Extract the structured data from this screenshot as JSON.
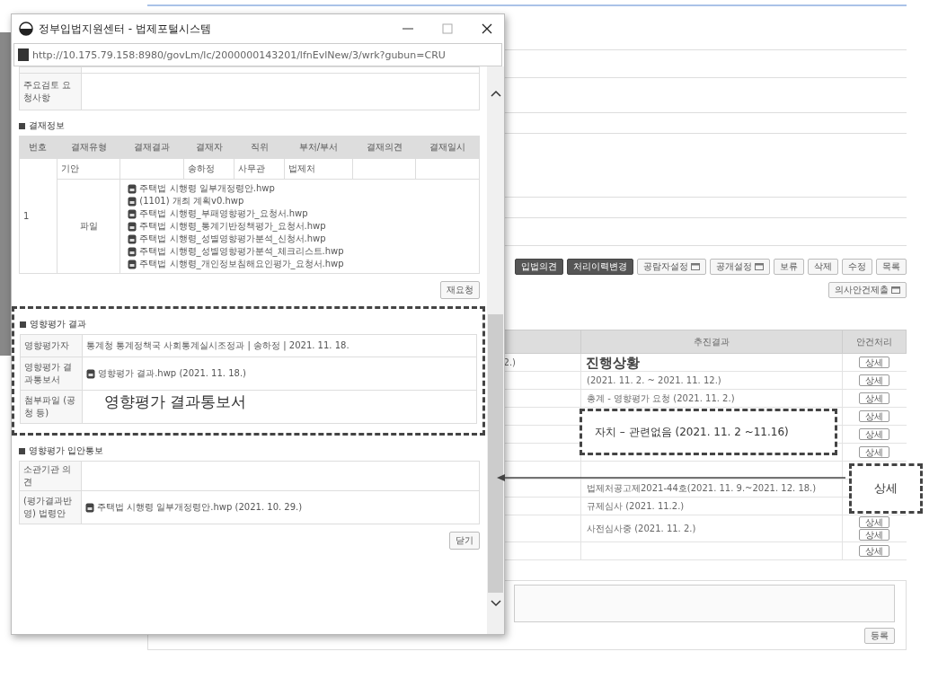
{
  "background_page": {
    "actions": [
      {
        "label": "입법의견",
        "kind": "dark",
        "has_icon": false
      },
      {
        "label": "처리이력변경",
        "kind": "dark",
        "has_icon": false
      },
      {
        "label": "공람자설정",
        "kind": "light",
        "has_icon": true
      },
      {
        "label": "공개설정",
        "kind": "light",
        "has_icon": true
      },
      {
        "label": "보류",
        "kind": "light",
        "has_icon": false
      },
      {
        "label": "삭제",
        "kind": "light",
        "has_icon": false
      },
      {
        "label": "수정",
        "kind": "light",
        "has_icon": false
      },
      {
        "label": "목록",
        "kind": "light",
        "has_icon": false
      }
    ],
    "submit_button": {
      "label": "의사안건제출",
      "has_icon": true
    },
    "table": {
      "columns": [
        "추진결과",
        "안건처리"
      ],
      "rows": [
        {
          "left": "2.)",
          "actions": [
            "상세"
          ]
        },
        {
          "result": "(2021. 11. 2. ~ 2021. 11. 12.)",
          "actions": [
            "상세"
          ]
        },
        {
          "result": "총계 - 영향평가 요청 (2021. 11. 2.)",
          "actions": [
            "상세"
          ]
        },
        {
          "actions": [
            "상세"
          ]
        },
        {
          "actions": [
            "상세"
          ]
        },
        {
          "actions": [
            "상세"
          ]
        },
        {
          "actions": []
        },
        {
          "result": "법제처공고제2021-44호(2021. 11. 9.~2021. 12. 18.)",
          "actions": []
        },
        {
          "result": "규제심사 (2021. 11.2.)",
          "actions": []
        },
        {
          "result": "사전심사중 (2021. 11. 2.)",
          "actions": [
            "상세",
            "상세"
          ]
        },
        {
          "actions": [
            "상세"
          ]
        }
      ]
    },
    "register_button": "등록"
  },
  "popup": {
    "title": "정부입법지원센터 - 법제포털시스템",
    "url": "http://10.175.79.158:8980/govLm/lc/2000000143201/lfnEvlNew/3/wrk?gubun=CRU",
    "review": {
      "label": "주요검토 요청사항"
    },
    "approval": {
      "title": "결재정보",
      "columns": [
        "번호",
        "결재유형",
        "결재결과",
        "결재자",
        "직위",
        "부처/부서",
        "결재의견",
        "결재일시"
      ],
      "number": "1",
      "row": {
        "type": "기안",
        "approver": "송하정",
        "position": "사무관",
        "department": "법제처"
      },
      "file_label": "파일",
      "files": [
        "주택법 시행령 일부개정령안.hwp",
        "(1101) 개최 계획v0.hwp",
        "주택법 시행령_부패영향평가_요청서.hwp",
        "주택법 시행령_통계기반정책평가_요청서.hwp",
        "주택법 시행령_성별영향평가분석_신청서.hwp",
        "주택법 시행령_성별영향평가분석_체크리스트.hwp",
        "주택법 시행령_개인정보침해요인평가_요청서.hwp"
      ],
      "rerequest_button": "재요청"
    },
    "impact_result": {
      "title": "영향평가 결과",
      "rows": [
        {
          "label": "영향평가자",
          "kind": "text",
          "value": "통계청 통계정책국 사회통계실시조정과 | 송하정 | 2021. 11. 18."
        },
        {
          "label": "영향평가 결과통보서",
          "kind": "file",
          "value": "영향평가 결과.hwp (2021. 11. 18.)"
        },
        {
          "label": "첨부파일 (공청 등)",
          "kind": "text"
        }
      ]
    },
    "impact_notice": {
      "title": "영향평가 입안통보",
      "rows": [
        {
          "label": "소관기관 의견",
          "kind": "text"
        },
        {
          "label": "(평가결과반영) 법령안",
          "kind": "file",
          "value": "주택법 시행령 일부개정령안.hwp (2021. 10. 29.)"
        }
      ]
    },
    "close_button": "닫기"
  },
  "annotations": {
    "result_label": "영향평가 결과통보서",
    "progress_label": "진행상황",
    "highlight": "자치 – 관련없음 (2021. 11.  2 ~11.16)",
    "detail_label": "상세"
  }
}
